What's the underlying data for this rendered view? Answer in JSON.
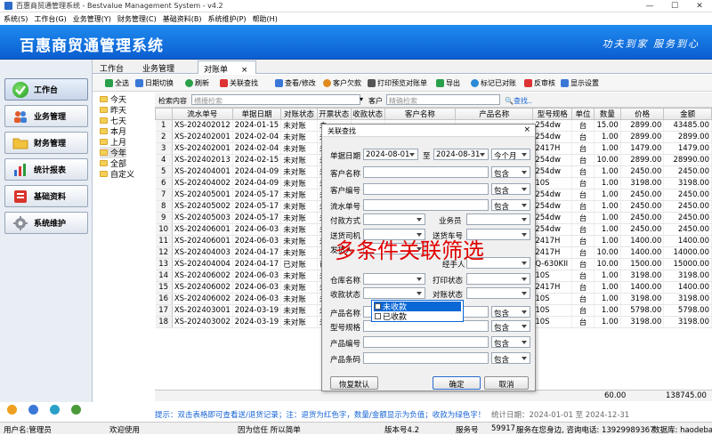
{
  "window": {
    "title": "百惠商贸通管理系统 - Bestvalue Management System - v4.2",
    "minimize": "—",
    "maximize": "☐",
    "close": "✕"
  },
  "menu": [
    "系统(S)",
    "工作台(G)",
    "业务管理(Y)",
    "财务管理(C)",
    "基础资料(B)",
    "系统维护(P)",
    "帮助(H)"
  ],
  "banner": {
    "system_name": "百惠商贸通管理系统",
    "slogan": "功夫到家  服务到心"
  },
  "nav": [
    {
      "label": "工作台",
      "icon": "check-circle-icon"
    },
    {
      "label": "业务管理",
      "icon": "people-icon"
    },
    {
      "label": "财务管理",
      "icon": "folder-icon"
    },
    {
      "label": "统计报表",
      "icon": "bar-chart-icon"
    },
    {
      "label": "基础资料",
      "icon": "database-icon"
    },
    {
      "label": "系统维护",
      "icon": "gear-icon"
    }
  ],
  "tabs": [
    "工作台",
    "业务管理",
    "对账单"
  ],
  "tab_close": "×",
  "toolbar": [
    "全选",
    "日期切换",
    "刷新",
    "关联查找",
    "查看/修改",
    "客户欠款",
    "打印预览对账单",
    "导出",
    "标记已对账",
    "反审核",
    "显示设置"
  ],
  "tree": [
    "今天",
    "昨天",
    "七天",
    "本月",
    "上月",
    "今年",
    "全部",
    "自定义"
  ],
  "search": {
    "label": "检索内容",
    "placeholder": "横栅检索",
    "customer_label": "客户",
    "customer_placeholder": "精确检索",
    "find_button": "查找.."
  },
  "grid": {
    "columns": [
      "",
      "流水单号",
      "单据日期",
      "对账状态",
      "开票状态",
      "收款状态",
      "客户名称",
      "产品名称",
      "型号规格",
      "单位",
      "数量",
      "价格",
      "金额"
    ],
    "rows": [
      [
        "1",
        "XS-202402012",
        "2024-01-15",
        "未对账",
        "未",
        "",
        "",
        "",
        "254dw",
        "台",
        "15.00",
        "2899.00",
        "43485.00"
      ],
      [
        "2",
        "XS-202402001",
        "2024-02-04",
        "未对账",
        "未",
        "",
        "",
        "",
        "254dw",
        "台",
        "1.00",
        "2899.00",
        "2899.00"
      ],
      [
        "3",
        "XS-202402001",
        "2024-02-04",
        "未对账",
        "未",
        "",
        "",
        "",
        "2417H",
        "台",
        "1.00",
        "1479.00",
        "1479.00"
      ],
      [
        "4",
        "XS-202402013",
        "2024-02-15",
        "未对账",
        "未",
        "",
        "",
        "",
        "254dw",
        "台",
        "10.00",
        "2899.00",
        "28990.00"
      ],
      [
        "5",
        "XS-202404001",
        "2024-04-09",
        "未对账",
        "未",
        "",
        "",
        "",
        "254dw",
        "台",
        "1.00",
        "2450.00",
        "2450.00"
      ],
      [
        "6",
        "XS-202404002",
        "2024-04-09",
        "未对账",
        "未",
        "",
        "",
        "",
        "10S",
        "台",
        "1.00",
        "3198.00",
        "3198.00"
      ],
      [
        "7",
        "XS-202405001",
        "2024-05-17",
        "未对账",
        "未",
        "",
        "",
        "",
        "254dw",
        "台",
        "1.00",
        "2450.00",
        "2450.00"
      ],
      [
        "8",
        "XS-202405002",
        "2024-05-17",
        "未对账",
        "未",
        "",
        "",
        "",
        "254dw",
        "台",
        "1.00",
        "2450.00",
        "2450.00"
      ],
      [
        "9",
        "XS-202405003",
        "2024-05-17",
        "未对账",
        "未",
        "",
        "",
        "",
        "254dw",
        "台",
        "1.00",
        "2450.00",
        "2450.00"
      ],
      [
        "10",
        "XS-202406001",
        "2024-06-03",
        "未对账",
        "未",
        "",
        "",
        "",
        "254dw",
        "台",
        "1.00",
        "2450.00",
        "2450.00"
      ],
      [
        "11",
        "XS-202406001",
        "2024-06-03",
        "未对账",
        "未",
        "",
        "",
        "",
        "2417H",
        "台",
        "1.00",
        "1400.00",
        "1400.00"
      ],
      [
        "12",
        "XS-202404003",
        "2024-04-17",
        "未对账",
        "未",
        "",
        "",
        "",
        "2417H",
        "台",
        "10.00",
        "1400.00",
        "14000.00"
      ],
      [
        "13",
        "XS-202404004",
        "2024-04-17",
        "已对账",
        "已",
        "",
        "",
        "",
        "Q-630KII",
        "台",
        "10.00",
        "1500.00",
        "15000.00"
      ],
      [
        "14",
        "XS-202406002",
        "2024-06-03",
        "未对账",
        "未",
        "",
        "",
        "",
        "10S",
        "台",
        "1.00",
        "3198.00",
        "3198.00"
      ],
      [
        "15",
        "XS-202406002",
        "2024-06-03",
        "未对账",
        "未",
        "",
        "",
        "",
        "2417H",
        "台",
        "1.00",
        "1400.00",
        "1400.00"
      ],
      [
        "16",
        "XS-202406002",
        "2024-06-03",
        "未对账",
        "未",
        "",
        "",
        "",
        "10S",
        "台",
        "1.00",
        "3198.00",
        "3198.00"
      ],
      [
        "17",
        "XS-202403001",
        "2024-03-19",
        "未对账",
        "未",
        "",
        "",
        "",
        "10S",
        "台",
        "1.00",
        "5798.00",
        "5798.00"
      ],
      [
        "18",
        "XS-202403002",
        "2024-03-19",
        "未对账",
        "未",
        "",
        "",
        "",
        "10S",
        "台",
        "1.00",
        "3198.00",
        "3198.00"
      ]
    ],
    "totals": {
      "qty": "60.00",
      "amount": "138745.00"
    }
  },
  "hint": "提示：双击表格即可查看送/退货记录；注：退货为红色字，数量/金额显示为负值；收款为绿色字！",
  "period": "统计日期：2024-01-01 至 2024-12-31",
  "status": [
    "用户名:管理员",
    "欢迎使用",
    "因为信任 所以简单",
    "版本号4.2",
    "服务号",
    "59917",
    "服务在您身边, 咨询电话: 13929989367",
    "数据库: haodebase"
  ],
  "dialog": {
    "title": "关联查找",
    "close": "×",
    "date_label": "单据日期",
    "date_from": "2024-08-01",
    "date_to_label": "至",
    "date_to": "2024-08-31",
    "date_range": "今个月",
    "rows": [
      "客户名称",
      "客户编号",
      "流水单号",
      "付款方式",
      "送货司机",
      "发货人",
      "仓库名称",
      "收款状态",
      "产品名称",
      "型号规格",
      "产品编号",
      "产品条码"
    ],
    "salesman": "业务员",
    "delivery_no": "送货车号",
    "handler": "经手人",
    "print_status": "打印状态",
    "recon_status": "对账状态",
    "contains": "包含",
    "buttons": {
      "reset": "恢复默认",
      "ok": "确定",
      "cancel": "取消"
    }
  },
  "dropdown": [
    "未收款",
    "已收款"
  ],
  "overlay_text": "多条件关联筛选",
  "colors": {
    "banner": "#0b5ed0",
    "selection": "#0a67d6",
    "hint": "#1664d6",
    "overlay": "#e00000"
  }
}
